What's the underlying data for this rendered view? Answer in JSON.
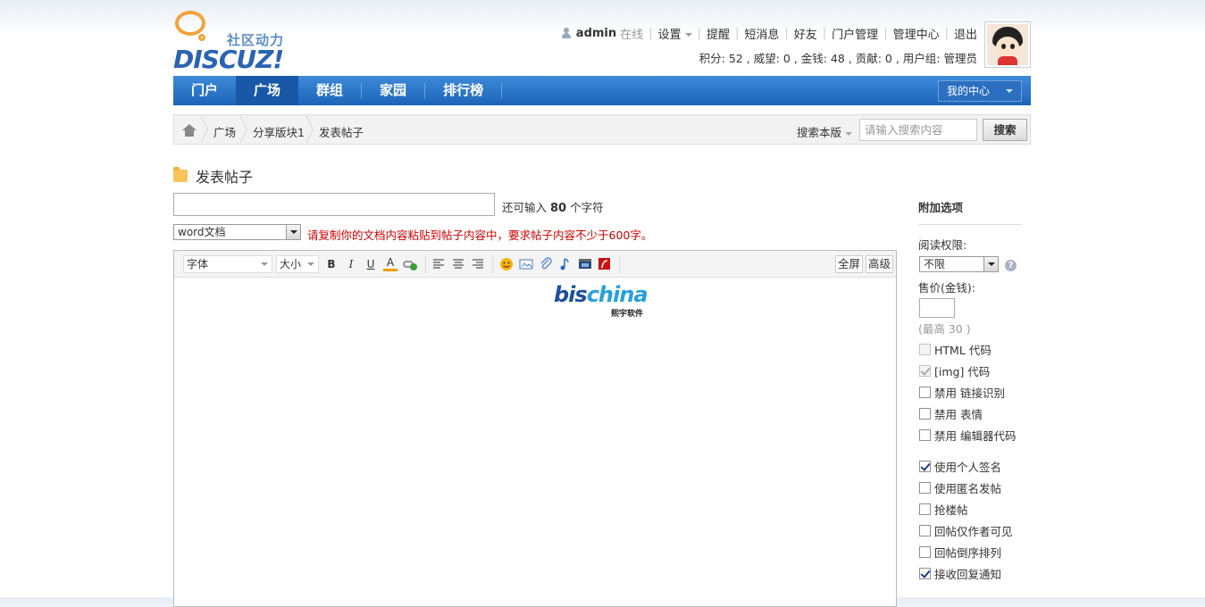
{
  "logo": {
    "cn": "社区动力",
    "en": "DISCUZ!"
  },
  "topnav": {
    "username": "admin",
    "status": "在线",
    "links": [
      "设置",
      "提醒",
      "短消息",
      "好友",
      "门户管理",
      "管理中心",
      "退出"
    ]
  },
  "userinfo": "积分: 52 , 威望: 0 , 金钱: 48 , 贡献: 0 , 用户组: 管理员",
  "nav": {
    "items": [
      "门户",
      "广场",
      "群组",
      "家园",
      "排行榜"
    ],
    "active": "广场",
    "mycenter": "我的中心"
  },
  "breadcrumb": [
    "广场",
    "分享版块1",
    "发表帖子"
  ],
  "search": {
    "scope": "搜索本版",
    "placeholder": "请输入搜索内容",
    "button": "搜索"
  },
  "page_title": "发表帖子",
  "subject": {
    "value": "",
    "hint_prefix": "还可输入",
    "remaining": "80",
    "hint_suffix": "个字符"
  },
  "type_select": {
    "value": "word文档",
    "notice": "请复制你的文档内容粘贴到帖子内容中，要求帖子内容不少于600字。"
  },
  "editor": {
    "font_select": "字体",
    "size_select": "大小",
    "fullscreen": "全屏",
    "advanced": "高级",
    "content_logo_main": "bis",
    "content_logo_accent": "china",
    "content_logo_sub": "熙宇软件"
  },
  "side": {
    "title": "附加选项",
    "read_perm_label": "阅读权限:",
    "read_perm_value": "不限",
    "price_label": "售价(金钱):",
    "price_max": "(最高 30 )",
    "options_group1": [
      {
        "label": "HTML 代码",
        "checked": false,
        "disabled": true
      },
      {
        "label": "[img] 代码",
        "checked": true,
        "disabled": true
      },
      {
        "label": "禁用 链接识别",
        "checked": false,
        "disabled": false
      },
      {
        "label": "禁用 表情",
        "checked": false,
        "disabled": false
      },
      {
        "label": "禁用 编辑器代码",
        "checked": false,
        "disabled": false
      }
    ],
    "options_group2": [
      {
        "label": "使用个人签名",
        "checked": true,
        "disabled": false
      },
      {
        "label": "使用匿名发帖",
        "checked": false,
        "disabled": false
      },
      {
        "label": "抢楼帖",
        "checked": false,
        "disabled": false
      },
      {
        "label": "回帖仅作者可见",
        "checked": false,
        "disabled": false
      },
      {
        "label": "回帖倒序排列",
        "checked": false,
        "disabled": false
      },
      {
        "label": "接收回复通知",
        "checked": true,
        "disabled": false
      }
    ]
  },
  "colors": {
    "nav_blue": "#1d64b8",
    "notice_red": "#cc0000",
    "logo_orange": "#f2a33a"
  }
}
